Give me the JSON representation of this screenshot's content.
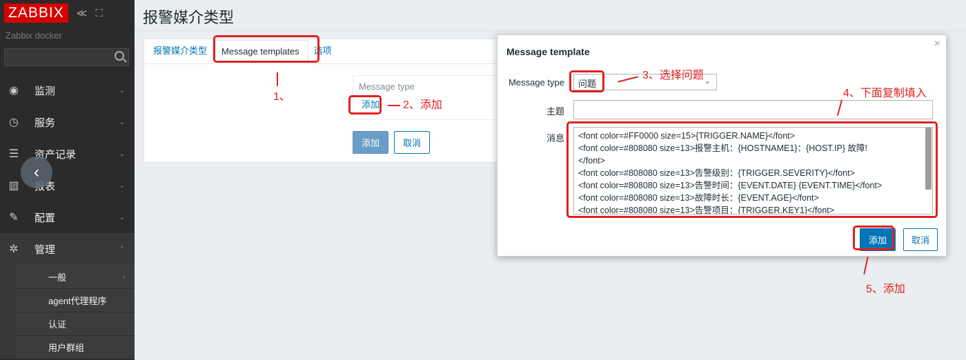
{
  "sidebar": {
    "logo": "ZABBIX",
    "collapse_glyph": "≪",
    "kiosk_glyph": "⛶",
    "server_name": "Zabbix docker",
    "menu": [
      {
        "label": "监测",
        "icon": "eye-icon",
        "glyph": "◉"
      },
      {
        "label": "服务",
        "icon": "clock-icon",
        "glyph": "◷"
      },
      {
        "label": "资产记录",
        "icon": "list-icon",
        "glyph": "☰"
      },
      {
        "label": "报表",
        "icon": "bar-chart-icon",
        "glyph": "▥"
      },
      {
        "label": "配置",
        "icon": "wrench-icon",
        "glyph": "✎"
      },
      {
        "label": "管理",
        "icon": "gear-icon",
        "glyph": "✲"
      }
    ],
    "submenu": [
      {
        "label": "一般"
      },
      {
        "label": "agent代理程序"
      },
      {
        "label": "认证"
      },
      {
        "label": "用户群组"
      }
    ]
  },
  "page": {
    "title": "报警媒介类型",
    "tabs": [
      "报警媒介类型",
      "Message templates",
      "选项"
    ],
    "message_type_label": "Message type",
    "add_link": "添加",
    "add_button": "添加",
    "cancel_button": "取消"
  },
  "dialog": {
    "title": "Message template",
    "close": "×",
    "message_type_label": "Message type",
    "message_type_value": "问题",
    "subject_label": "主题",
    "message_label": "消息",
    "message_lines": [
      "<font color=#FF0000 size=15>{TRIGGER.NAME}</font>",
      "<font color=#808080 size=13>报警主机：{HOSTNAME1}：{HOST.IP} 故障!",
      "</font>",
      "<font color=#808080 size=13>告警级别：{TRIGGER.SEVERITY}</font>",
      "<font color=#808080 size=13>告警时间：{EVENT.DATE} {EVENT.TIME}</font>",
      "<font color=#808080 size=13>故障时长：{EVENT.AGE}</font>",
      "<font color=#808080 size=13>告警项目：{TRIGGER.KEY1}</font>"
    ],
    "add_button": "添加",
    "cancel_button": "取消"
  },
  "annotations": {
    "step1": "1、",
    "step2": "2、添加",
    "step3": "3、选择问题",
    "step4": "4、下面复制填入",
    "step5": "5、添加"
  },
  "colors": {
    "annotation_red": "#e02020",
    "link_blue": "#0275b8",
    "sidebar_bg": "#2b2b2b",
    "logo_red": "#d40000"
  }
}
